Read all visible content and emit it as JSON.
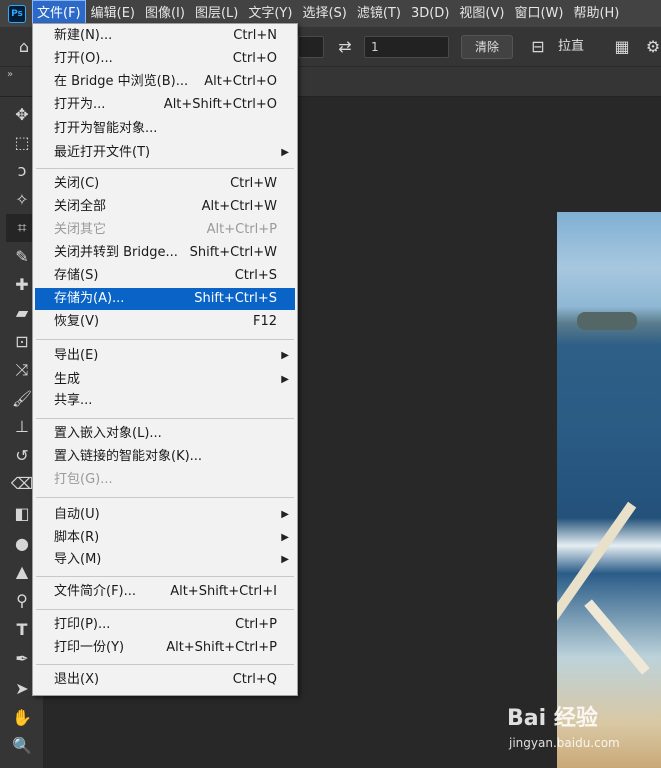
{
  "menubar": {
    "items": [
      "文件(F)",
      "编辑(E)",
      "图像(I)",
      "图层(L)",
      "文字(Y)",
      "选择(S)",
      "滤镜(T)",
      "3D(D)",
      "视图(V)",
      "窗口(W)",
      "帮助(H)"
    ],
    "logo": "Ps",
    "active_index": 0
  },
  "options": {
    "field1_value": "1",
    "clear_label": "清除",
    "straighten_label": "拉直"
  },
  "icons": {
    "swap": "swap-arrows-icon",
    "straighten": "straighten-icon",
    "grid": "grid-overlay-icon",
    "gear": "gear-icon"
  },
  "file_menu": {
    "items": [
      {
        "label": "新建(N)...",
        "shortcut": "Ctrl+N"
      },
      {
        "label": "打开(O)...",
        "shortcut": "Ctrl+O"
      },
      {
        "label": "在 Bridge 中浏览(B)...",
        "shortcut": "Alt+Ctrl+O"
      },
      {
        "label": "打开为...",
        "shortcut": "Alt+Shift+Ctrl+O"
      },
      {
        "label": "打开为智能对象...",
        "shortcut": ""
      },
      {
        "label": "最近打开文件(T)",
        "shortcut": "",
        "submenu": true
      },
      {
        "label": "关闭(C)",
        "shortcut": "Ctrl+W"
      },
      {
        "label": "关闭全部",
        "shortcut": "Alt+Ctrl+W"
      },
      {
        "label": "关闭其它",
        "shortcut": "Alt+Ctrl+P",
        "disabled": true
      },
      {
        "label": "关闭并转到 Bridge...",
        "shortcut": "Shift+Ctrl+W"
      },
      {
        "label": "存储(S)",
        "shortcut": "Ctrl+S"
      },
      {
        "label": "存储为(A)...",
        "shortcut": "Shift+Ctrl+S",
        "highlighted": true
      },
      {
        "label": "恢复(V)",
        "shortcut": "F12"
      },
      {
        "label": "导出(E)",
        "shortcut": "",
        "submenu": true
      },
      {
        "label": "生成",
        "shortcut": "",
        "submenu": true
      },
      {
        "label": "共享...",
        "shortcut": ""
      },
      {
        "label": "置入嵌入对象(L)...",
        "shortcut": ""
      },
      {
        "label": "置入链接的智能对象(K)...",
        "shortcut": ""
      },
      {
        "label": "打包(G)...",
        "shortcut": "",
        "disabled": true
      },
      {
        "label": "自动(U)",
        "shortcut": "",
        "submenu": true
      },
      {
        "label": "脚本(R)",
        "shortcut": "",
        "submenu": true
      },
      {
        "label": "导入(M)",
        "shortcut": "",
        "submenu": true
      },
      {
        "label": "文件简介(F)...",
        "shortcut": "Alt+Shift+Ctrl+I"
      },
      {
        "label": "打印(P)...",
        "shortcut": "Ctrl+P"
      },
      {
        "label": "打印一份(Y)",
        "shortcut": "Alt+Shift+Ctrl+P"
      },
      {
        "label": "退出(X)",
        "shortcut": "Ctrl+Q"
      }
    ]
  },
  "tools": [
    "move-tool-icon",
    "marquee-tool-icon",
    "lasso-tool-icon",
    "magic-wand-icon",
    "crop-tool-icon",
    "eyedropper-icon",
    "spot-healing-icon",
    "patch-tool-icon",
    "content-aware-move-icon",
    "brush-tool-icon",
    "clone-stamp-icon",
    "history-brush-icon",
    "eraser-icon",
    "gradient-icon",
    "blur-icon",
    "sharpen-icon",
    "dodge-icon",
    "type-tool-icon",
    "pen-tool-icon",
    "path-select-icon",
    "hand-tool-icon",
    "zoom-tool-icon"
  ],
  "watermark": {
    "logo": "Bai 经验",
    "sub": "jingyan.baidu.com"
  }
}
